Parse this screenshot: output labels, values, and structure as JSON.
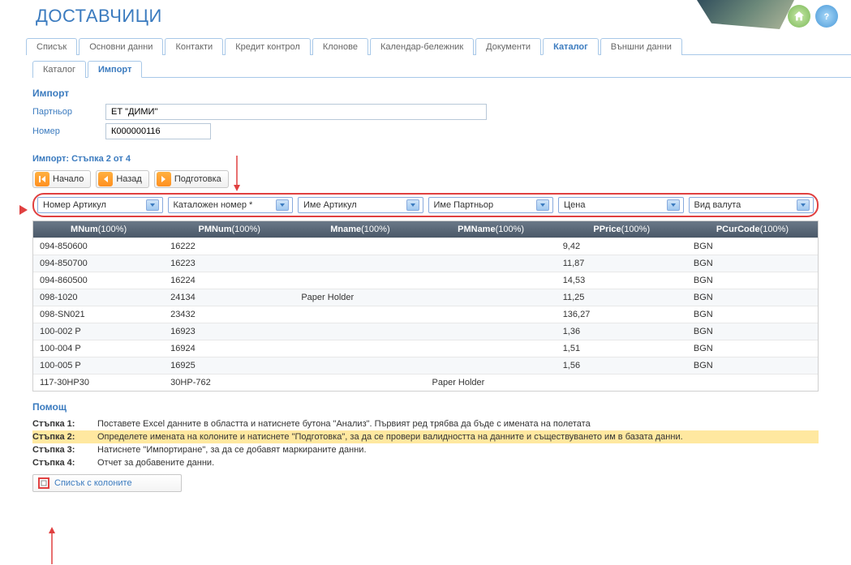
{
  "header": {
    "title": "ДОСТАВЧИЦИ"
  },
  "tabs": [
    "Списък",
    "Основни данни",
    "Контакти",
    "Кредит контрол",
    "Клонове",
    "Календар-бележник",
    "Документи",
    "Каталог",
    "Външни данни"
  ],
  "tabs_active": 7,
  "subtabs": [
    "Каталог",
    "Импорт"
  ],
  "subtabs_active": 1,
  "import": {
    "section_label": "Импорт",
    "partner_label": "Партньор",
    "partner_value": "ЕТ \"ДИМИ\"",
    "number_label": "Номер",
    "number_value": "К000000116",
    "step_title": "Импорт: Стъпка 2 от 4",
    "buttons": {
      "start": "Начало",
      "back": "Назад",
      "prepare": "Подготовка"
    }
  },
  "mappings": [
    "Номер Артикул",
    "Каталожен номер *",
    "Име Артикул",
    "Име Партньор",
    "Цена",
    "Вид валута"
  ],
  "columns": [
    {
      "name": "MNum",
      "pct": "(100%)"
    },
    {
      "name": "PMNum",
      "pct": "(100%)"
    },
    {
      "name": "Mname",
      "pct": "(100%)"
    },
    {
      "name": "PMName",
      "pct": "(100%)"
    },
    {
      "name": "PPrice",
      "pct": "(100%)"
    },
    {
      "name": "PCurCode",
      "pct": "(100%)"
    }
  ],
  "rows": [
    [
      "094-850600",
      "16222",
      "",
      "",
      "9,42",
      "BGN"
    ],
    [
      "094-850700",
      "16223",
      "",
      "",
      "11,87",
      "BGN"
    ],
    [
      "094-860500",
      "16224",
      "",
      "",
      "14,53",
      "BGN"
    ],
    [
      "098-1020",
      "24134",
      "Paper Holder",
      "",
      "11,25",
      "BGN"
    ],
    [
      "098-SN021",
      "23432",
      "",
      "",
      "136,27",
      "BGN"
    ],
    [
      "100-002 P",
      "16923",
      "",
      "",
      "1,36",
      "BGN"
    ],
    [
      "100-004 P",
      "16924",
      "",
      "",
      "1,51",
      "BGN"
    ],
    [
      "100-005 P",
      "16925",
      "",
      "",
      "1,56",
      "BGN"
    ],
    [
      "117-30HP30",
      "30HP-762",
      "",
      "Paper Holder",
      "",
      ""
    ]
  ],
  "help": {
    "title": "Помощ",
    "steps": [
      {
        "k": "Стъпка 1:",
        "v": "Поставете Excel данните в областта и натиснете бутона \"Анализ\". Първият ред трябва да бъде с имената на полетата"
      },
      {
        "k": "Стъпка 2:",
        "v": "Определете имената на колоните и натиснете \"Подготовка\", за да се провери валидността на данните и съществуването им в базата данни.",
        "hl": true
      },
      {
        "k": "Стъпка 3:",
        "v": "Натиснете \"Импортиране\", за да се добавят маркираните данни."
      },
      {
        "k": "Стъпка 4:",
        "v": "Отчет за добавените данни."
      }
    ],
    "columns_button": "Списък с колоните"
  }
}
